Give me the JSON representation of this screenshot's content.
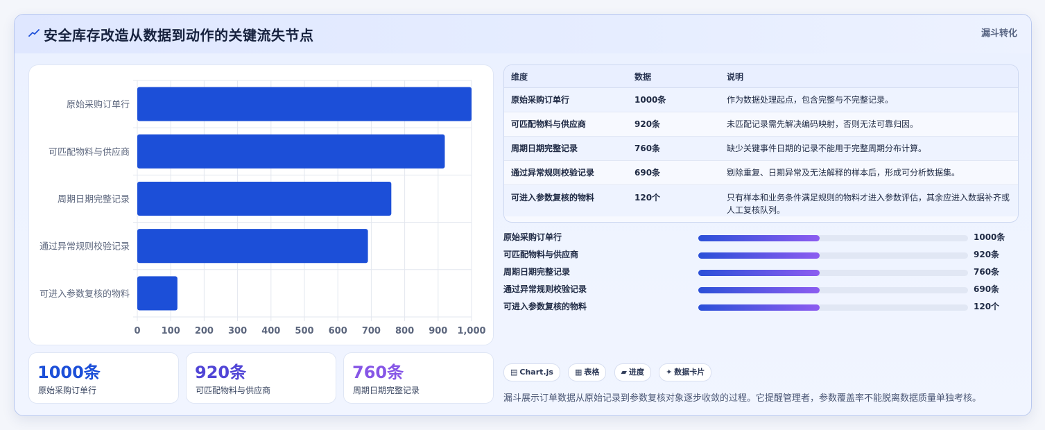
{
  "header": {
    "title": "安全库存改造从数据到动作的关键流失节点",
    "tag": "漏斗转化"
  },
  "chart_data": {
    "type": "bar",
    "orientation": "horizontal",
    "categories": [
      "原始采购订单行",
      "可匹配物料与供应商",
      "周期日期完整记录",
      "通过异常规则校验记录",
      "可进入参数复核的物料"
    ],
    "values": [
      1000,
      920,
      760,
      690,
      120
    ],
    "xlim": [
      0,
      1000
    ],
    "xticks": [
      "0",
      "100",
      "200",
      "300",
      "400",
      "500",
      "600",
      "700",
      "800",
      "900",
      "1,000"
    ],
    "grid": true,
    "bar_color": "#1c4fd8"
  },
  "kpis": [
    {
      "value": "1000条",
      "label": "原始采购订单行",
      "color": "#1c4fd8"
    },
    {
      "value": "920条",
      "label": "可匹配物料与供应商",
      "color": "#5145d6"
    },
    {
      "value": "760条",
      "label": "周期日期完整记录",
      "color": "#8656e6"
    }
  ],
  "table": {
    "headers": [
      "维度",
      "数据",
      "说明"
    ],
    "rows": [
      {
        "dim": "原始采购订单行",
        "val": "1000条",
        "desc": "作为数据处理起点，包含完整与不完整记录。"
      },
      {
        "dim": "可匹配物料与供应商",
        "val": "920条",
        "desc": "未匹配记录需先解决编码映射，否则无法可靠归因。"
      },
      {
        "dim": "周期日期完整记录",
        "val": "760条",
        "desc": "缺少关键事件日期的记录不能用于完整周期分布计算。"
      },
      {
        "dim": "通过异常规则校验记录",
        "val": "690条",
        "desc": "剔除重复、日期异常及无法解释的样本后，形成可分析数据集。"
      },
      {
        "dim": "可进入参数复核的物料",
        "val": "120个",
        "desc": "只有样本和业务条件满足规则的物料才进入参数评估，其余应进入数据补齐或人工复核队列。"
      }
    ]
  },
  "progress": [
    {
      "label": "原始采购订单行",
      "value": "1000条",
      "fill": 0.45
    },
    {
      "label": "可匹配物料与供应商",
      "value": "920条",
      "fill": 0.45
    },
    {
      "label": "周期日期完整记录",
      "value": "760条",
      "fill": 0.45
    },
    {
      "label": "通过异常规则校验记录",
      "value": "690条",
      "fill": 0.45
    },
    {
      "label": "可进入参数复核的物料",
      "value": "120个",
      "fill": 0.45
    }
  ],
  "chips": [
    {
      "icon": "▤",
      "label": "Chart.js"
    },
    {
      "icon": "▦",
      "label": "表格"
    },
    {
      "icon": "▰",
      "label": "进度"
    },
    {
      "icon": "✦",
      "label": "数据卡片"
    }
  ],
  "note": "漏斗展示订单数据从原始记录到参数复核对象逐步收敛的过程。它提醒管理者，参数覆盖率不能脱离数据质量单独考核。"
}
